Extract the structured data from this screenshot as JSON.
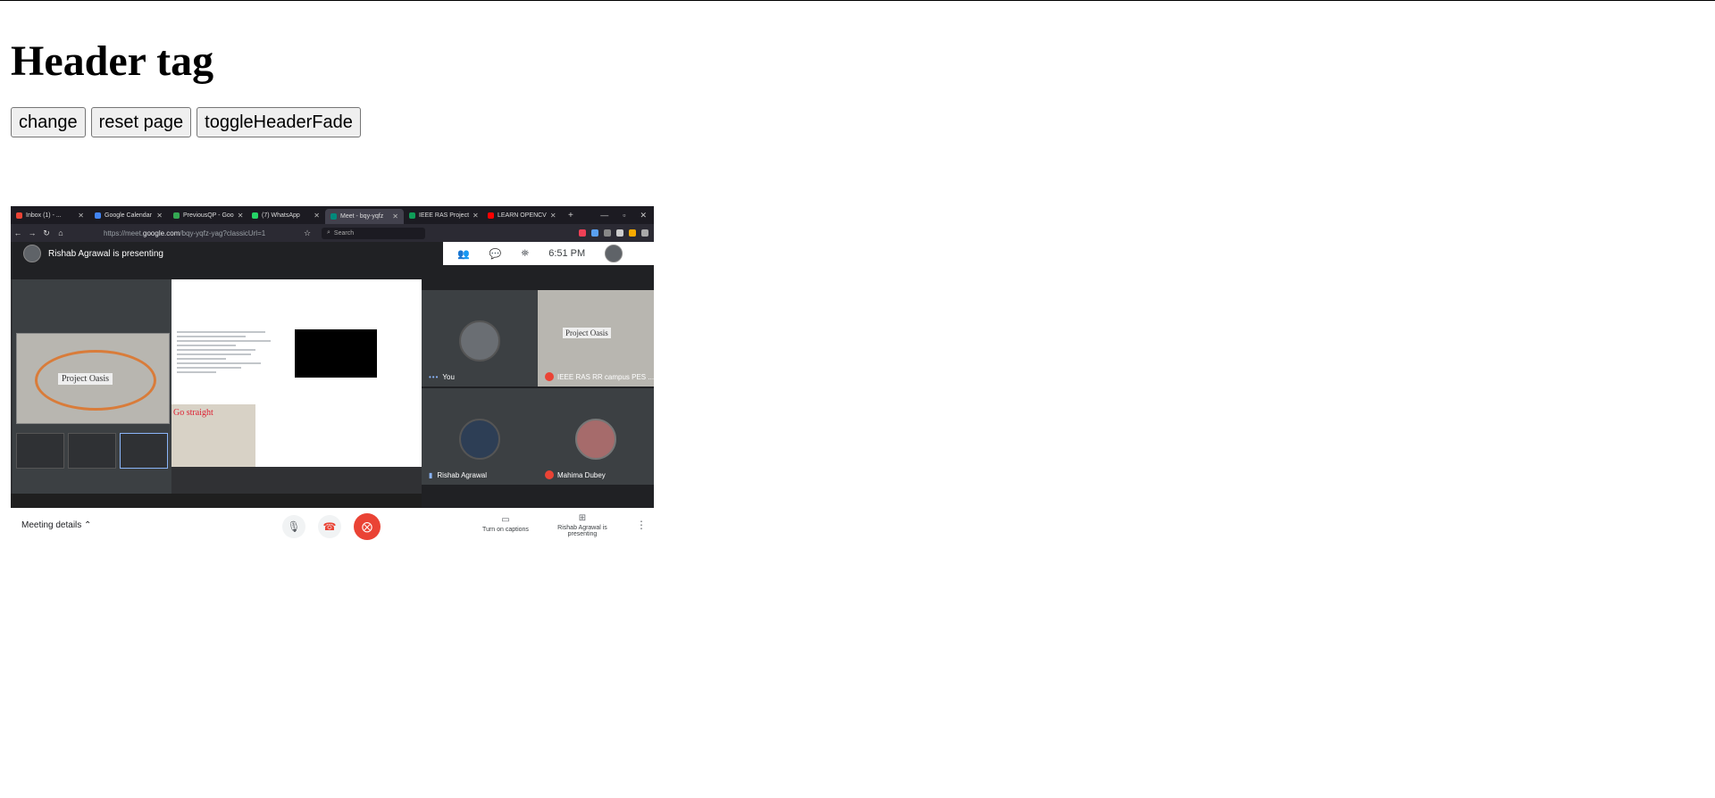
{
  "header": {
    "title": "Header tag"
  },
  "buttons": {
    "change": "change",
    "reset": "reset page",
    "toggle": "toggleHeaderFade"
  },
  "image": {
    "tabs": [
      {
        "label": "Inbox (1) - ...",
        "color": "#ea4335"
      },
      {
        "label": "Google Calendar",
        "color": "#4285f4"
      },
      {
        "label": "PreviousQP - Goo",
        "color": "#34a853"
      },
      {
        "label": "(7) WhatsApp",
        "color": "#25d366"
      },
      {
        "label": "Meet - bqy-yqfz",
        "color": "#00897b",
        "active": true
      },
      {
        "label": "IEEE RAS Project",
        "color": "#0f9d58"
      },
      {
        "label": "LEARN OPENCV",
        "color": "#ff0000"
      }
    ],
    "url_prefix": "https://meet.",
    "url_domain": "google.com",
    "url_path": "/bqy-yqfz-yag?classicUrl=1",
    "search_placeholder": "Search",
    "presenting_text": "Rishab Agrawal is presenting",
    "time": "6:51 PM",
    "straight_text": "Go straight",
    "oasis_text": "Project Oasis",
    "participants": [
      {
        "name": "You"
      },
      {
        "name": "IEEE RAS RR campus PES ..."
      },
      {
        "name": "Rishab Agrawal"
      },
      {
        "name": "Mahima Dubey"
      }
    ],
    "meeting_details": "Meeting details",
    "captions": "Turn on captions",
    "presenter_status": "Rishab Agrawal is presenting"
  }
}
